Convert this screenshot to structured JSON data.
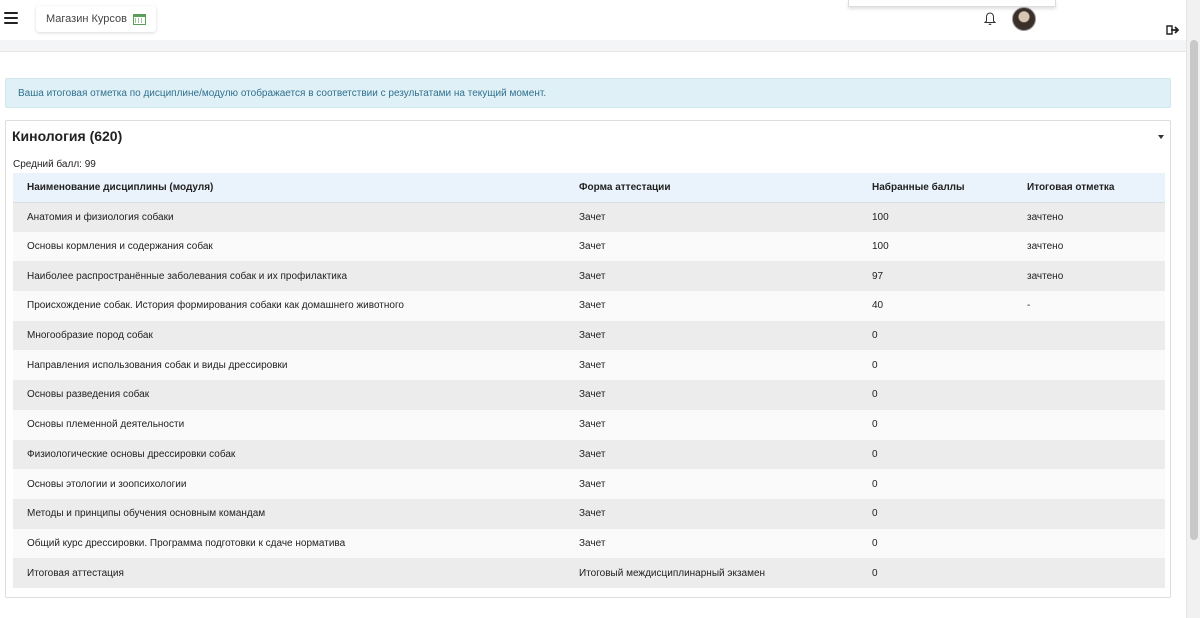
{
  "header": {
    "store_label": "Магазин Курсов"
  },
  "alert": {
    "text": "Ваша итоговая отметка по дисциплине/модулю отображается в соответствии с результатами на текущий момент."
  },
  "course": {
    "title": "Кинология (620)",
    "average": "Средний балл: 99",
    "columns": [
      "Наименование дисциплины (модуля)",
      "Форма аттестации",
      "Набранные баллы",
      "Итоговая отметка"
    ],
    "rows": [
      [
        "Анатомия и физиология собаки",
        "Зачет",
        "100",
        "зачтено"
      ],
      [
        "Основы кормления и содержания собак",
        "Зачет",
        "100",
        "зачтено"
      ],
      [
        "Наиболее распространённые заболевания собак и их профилактика",
        "Зачет",
        "97",
        "зачтено"
      ],
      [
        "Происхождение собак. История формирования собаки как домашнего животного",
        "Зачет",
        "40",
        "-"
      ],
      [
        "Многообразие пород собак",
        "Зачет",
        "0",
        ""
      ],
      [
        "Направления использования собак и виды дрессировки",
        "Зачет",
        "0",
        ""
      ],
      [
        "Основы разведения собак",
        "Зачет",
        "0",
        ""
      ],
      [
        "Основы племенной деятельности",
        "Зачет",
        "0",
        ""
      ],
      [
        "Физиологические основы дрессировки собак",
        "Зачет",
        "0",
        ""
      ],
      [
        "Основы этологии и зоопсихологии",
        "Зачет",
        "0",
        ""
      ],
      [
        "Методы и принципы обучения основным командам",
        "Зачет",
        "0",
        ""
      ],
      [
        "Общий курс дрессировки. Программа подготовки к сдаче норматива",
        "Зачет",
        "0",
        ""
      ],
      [
        "Итоговая аттестация",
        "Итоговый междисциплинарный экзамен",
        "0",
        ""
      ]
    ]
  },
  "icons": {
    "menu": "hamburger-menu-icon",
    "calendar": "calendar-icon",
    "bell": "bell-icon",
    "logout": "logout-icon",
    "collapse": "caret-down-icon"
  },
  "colors": {
    "alert_bg": "#dff1f6",
    "alert_text": "#31708f",
    "header_row": "#eaf3fb"
  }
}
